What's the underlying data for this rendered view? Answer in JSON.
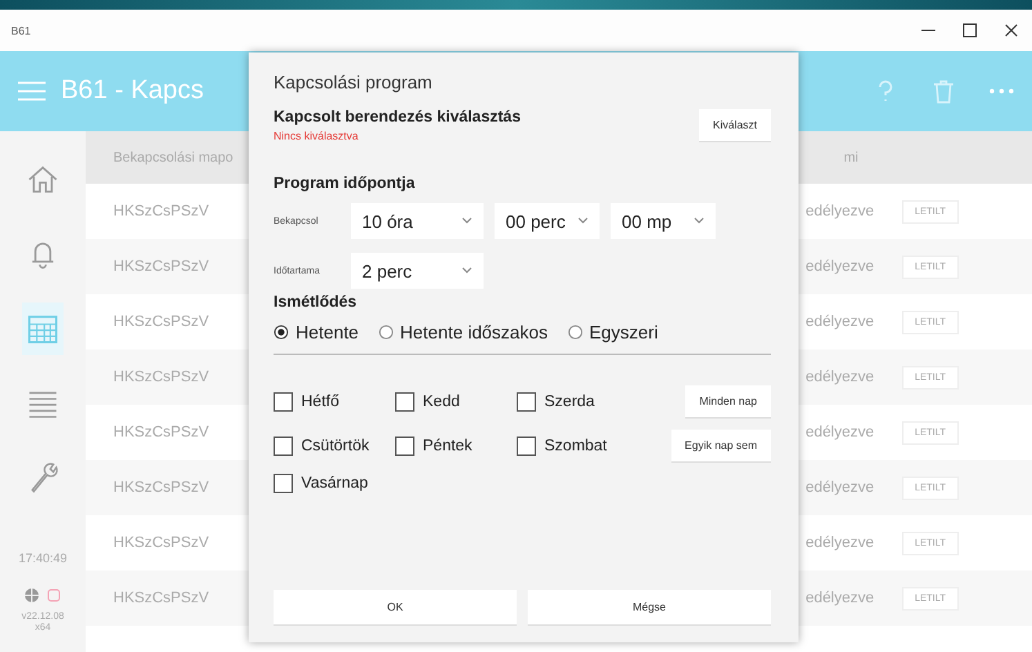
{
  "window": {
    "title": "B61"
  },
  "app_bar": {
    "title": "B61 - Kapcs"
  },
  "sidebar": {
    "items": [
      {
        "selected": false
      },
      {
        "selected": false
      },
      {
        "selected": true
      },
      {
        "selected": false
      },
      {
        "selected": false
      }
    ],
    "clock": "17:40:49",
    "version": [
      "v22.12.08",
      "x64"
    ]
  },
  "table": {
    "columns": [
      "Bekapcsolási mapo",
      "mi"
    ],
    "rows": [
      {
        "cells": [
          "HKSzCsPSzV",
          "edélyezve",
          "LETILT"
        ]
      },
      {
        "cells": [
          "HKSzCsPSzV",
          "edélyezve",
          "LETILT"
        ]
      },
      {
        "cells": [
          "HKSzCsPSzV",
          "edélyezve",
          "LETILT"
        ]
      },
      {
        "cells": [
          "HKSzCsPSzV",
          "edélyezve",
          "LETILT"
        ]
      },
      {
        "cells": [
          "HKSzCsPSzV",
          "edélyezve",
          "LETILT"
        ]
      },
      {
        "cells": [
          "HKSzCsPSzV",
          "edélyezve",
          "LETILT"
        ]
      },
      {
        "cells": [
          "HKSzCsPSzV",
          "edélyezve",
          "LETILT"
        ]
      },
      {
        "cells": [
          "HKSzCsPSzV",
          "edélyezve",
          "LETILT"
        ]
      }
    ]
  },
  "dialog": {
    "title": "Kapcsolási program",
    "device_heading": "Kapcsolt berendezés kiválasztás",
    "device_status": "Nincs kiválasztva",
    "select_button": "Kiválaszt",
    "time_heading": "Program időpontja",
    "start": {
      "label": "Bekapcsol",
      "fields": [
        "10 óra",
        "00 perc",
        "00 mp"
      ]
    },
    "duration": {
      "label": "Időtartama",
      "value": "2 perc"
    },
    "repeat_heading": "Ismétlődés",
    "repeat_options": [
      {
        "label": "Hetente",
        "selected": true
      },
      {
        "label": "Hetente időszakos",
        "selected": false
      },
      {
        "label": "Egyszeri",
        "selected": false
      }
    ],
    "days": [
      {
        "label": "Hétfő",
        "checked": false
      },
      {
        "label": "Kedd",
        "checked": false
      },
      {
        "label": "Szerda",
        "checked": false
      },
      {
        "label": "Csütörtök",
        "checked": false
      },
      {
        "label": "Péntek",
        "checked": false
      },
      {
        "label": "Szombat",
        "checked": false
      },
      {
        "label": "Vasárnap",
        "checked": false
      }
    ],
    "day_buttons": [
      "Minden nap",
      "Egyik nap sem"
    ],
    "buttons": [
      "OK",
      "Mégse"
    ]
  }
}
